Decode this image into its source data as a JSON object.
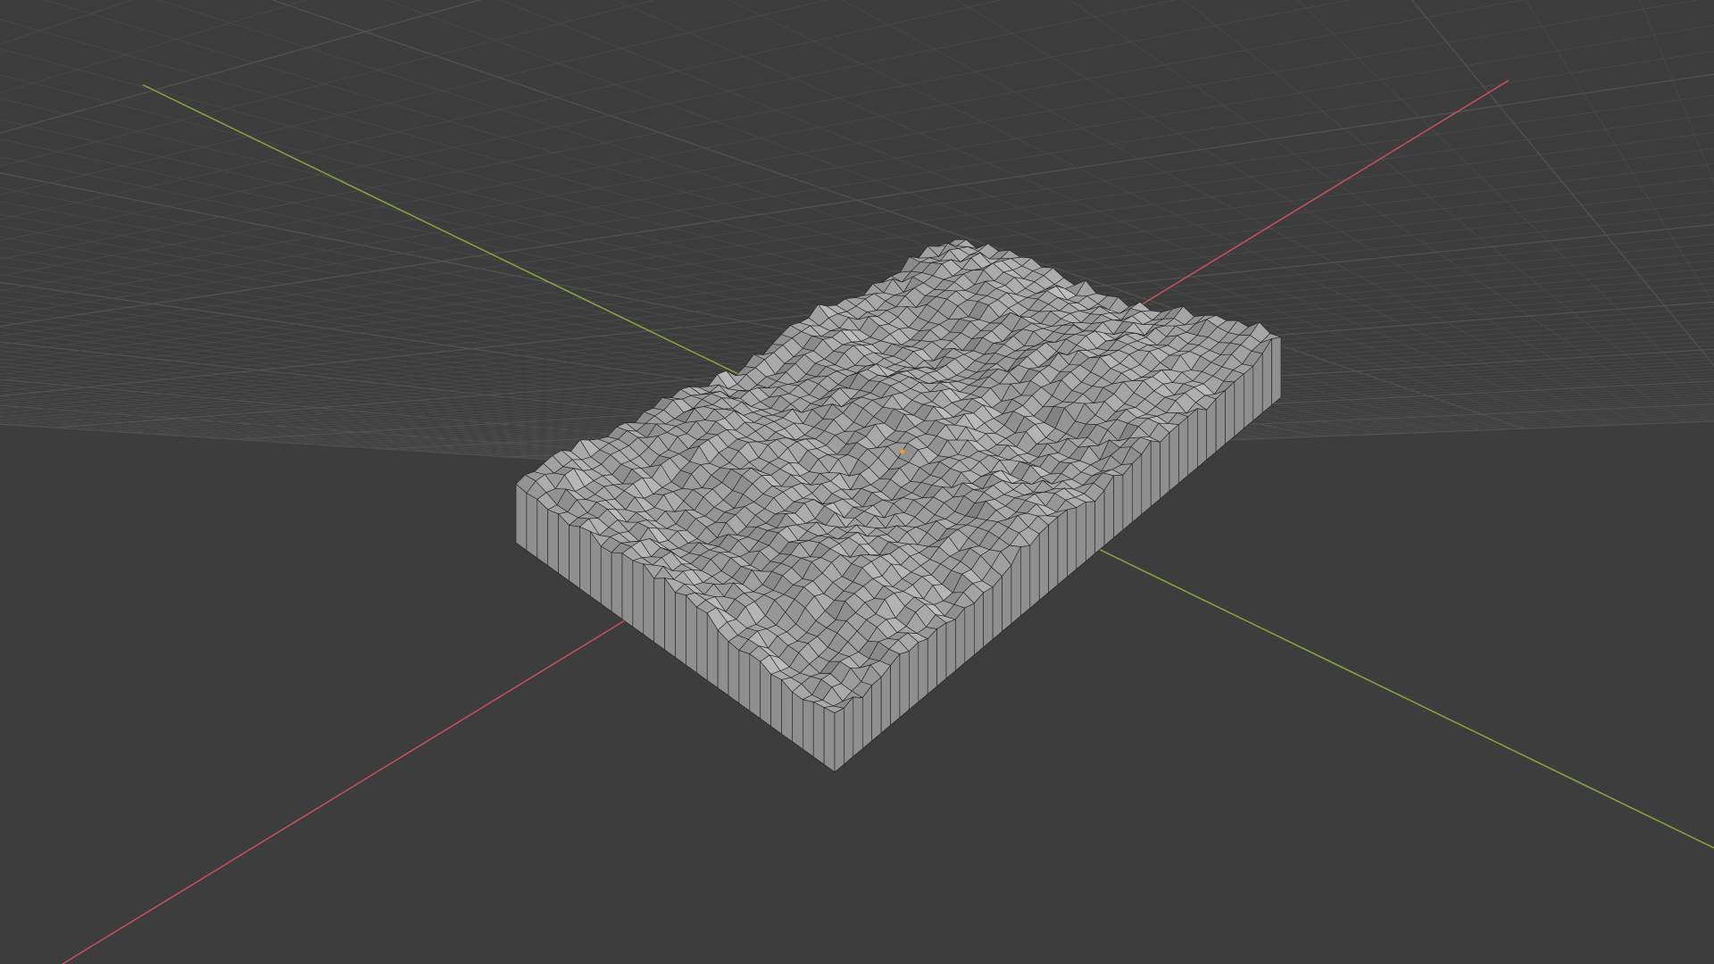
{
  "app": {
    "view": "3d-viewport",
    "mode": "object-mode-wireframe-overlay"
  },
  "viewport": {
    "background_color": "#3d3d3d",
    "grid_minor_color": "#4a4a4a",
    "grid_major_color": "#525252",
    "x_axis_color": "#c8505e",
    "y_axis_color": "#88a83a"
  },
  "object": {
    "name_visible": false,
    "type": "terrain-mesh",
    "face_color": "#a9a9a9",
    "side_color": "#8f8f8f",
    "edge_color": "#1e1e1e",
    "origin_color": "#f0a020"
  }
}
